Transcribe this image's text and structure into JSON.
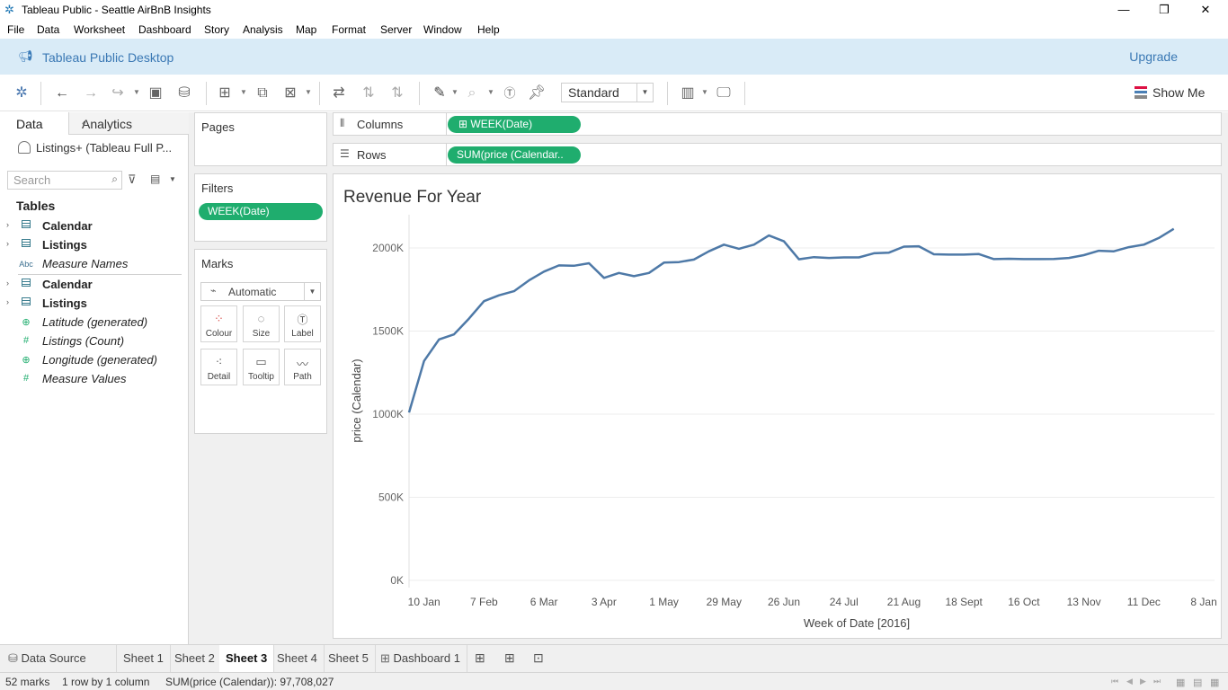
{
  "window": {
    "title": "Tableau Public - Seattle AirBnB Insights"
  },
  "menu": [
    "File",
    "Data",
    "Worksheet",
    "Dashboard",
    "Story",
    "Analysis",
    "Map",
    "Format",
    "Server",
    "Window",
    "Help"
  ],
  "banner": {
    "title": "Tableau Public Desktop",
    "upgrade": "Upgrade"
  },
  "toolbar": {
    "fit_select": "Standard",
    "show_me": "Show Me"
  },
  "datapane": {
    "tab_data": "Data",
    "tab_analytics": "Analytics",
    "datasource": "Listings+ (Tableau Full P...",
    "search_placeholder": "Search",
    "tables_heading": "Tables",
    "fields": [
      {
        "label": "Calendar",
        "icon": "table-icon"
      },
      {
        "label": "Listings",
        "icon": "table-icon"
      },
      {
        "label": "Measure Names",
        "icon": "Abc"
      },
      {
        "label": "Calendar",
        "icon": "table-icon"
      },
      {
        "label": "Listings",
        "icon": "table-icon"
      },
      {
        "label": "Latitude (generated)",
        "icon": "globe-icon"
      },
      {
        "label": "Listings (Count)",
        "icon": "#"
      },
      {
        "label": "Longitude (generated)",
        "icon": "globe-icon"
      },
      {
        "label": "Measure Values",
        "icon": "#"
      }
    ]
  },
  "cards": {
    "pages": "Pages",
    "filters": "Filters",
    "filter_pill": "WEEK(Date)",
    "marks": "Marks",
    "marks_type": "Automatic",
    "mark_buttons": [
      "Colour",
      "Size",
      "Label",
      "Detail",
      "Tooltip",
      "Path"
    ]
  },
  "shelves": {
    "columns_label": "Columns",
    "columns_pill": "WEEK(Date)",
    "rows_label": "Rows",
    "rows_pill": "SUM(price (Calendar.."
  },
  "chart_data": {
    "type": "line",
    "title": "Revenue For Year",
    "xlabel": "Week of Date [2016]",
    "ylabel": "price (Calendar)",
    "yticks": [
      "0K",
      "500K",
      "1000K",
      "1500K",
      "2000K"
    ],
    "ytick_values": [
      0,
      500000,
      1000000,
      1500000,
      2000000
    ],
    "ylim": [
      0,
      2200000
    ],
    "xticks": [
      "10 Jan",
      "7 Feb",
      "6 Mar",
      "3 Apr",
      "1 May",
      "29 May",
      "26 Jun",
      "24 Jul",
      "21 Aug",
      "18 Sept",
      "16 Oct",
      "13 Nov",
      "11 Dec",
      "8 Jan"
    ],
    "xlim": [
      "2016-01-03",
      "2017-01-13"
    ],
    "line_color": "#4e79a7",
    "x": [
      "2016-01-03",
      "2016-01-10",
      "2016-01-17",
      "2016-01-24",
      "2016-01-31",
      "2016-02-07",
      "2016-02-14",
      "2016-02-21",
      "2016-02-28",
      "2016-03-06",
      "2016-03-13",
      "2016-03-20",
      "2016-03-27",
      "2016-04-03",
      "2016-04-10",
      "2016-04-17",
      "2016-04-24",
      "2016-05-01",
      "2016-05-08",
      "2016-05-15",
      "2016-05-22",
      "2016-05-29",
      "2016-06-05",
      "2016-06-12",
      "2016-06-19",
      "2016-06-26",
      "2016-07-03",
      "2016-07-10",
      "2016-07-17",
      "2016-07-24",
      "2016-07-31",
      "2016-08-07",
      "2016-08-14",
      "2016-08-21",
      "2016-08-28",
      "2016-09-04",
      "2016-09-11",
      "2016-09-18",
      "2016-09-25",
      "2016-10-02",
      "2016-10-09",
      "2016-10-16",
      "2016-10-23",
      "2016-10-30",
      "2016-11-06",
      "2016-11-13",
      "2016-11-20",
      "2016-11-27",
      "2016-12-04",
      "2016-12-11",
      "2016-12-18",
      "2016-12-25"
    ],
    "values": [
      1010000,
      1320000,
      1450000,
      1480000,
      1575000,
      1680000,
      1715000,
      1740000,
      1805000,
      1858000,
      1895000,
      1893000,
      1908000,
      1820000,
      1850000,
      1830000,
      1850000,
      1912000,
      1915000,
      1930000,
      1980000,
      2020000,
      1995000,
      2020000,
      2075000,
      2040000,
      1932000,
      1945000,
      1940000,
      1943000,
      1943000,
      1968000,
      1972000,
      2008000,
      2010000,
      1962000,
      1960000,
      1960000,
      1963000,
      1933000,
      1935000,
      1933000,
      1933000,
      1934000,
      1940000,
      1957000,
      1983000,
      1980000,
      2005000,
      2020000,
      2060000,
      2115000
    ]
  },
  "sheet_tabs": [
    "Data Source",
    "Sheet 1",
    "Sheet 2",
    "Sheet 3",
    "Sheet 4",
    "Sheet 5",
    "Dashboard 1"
  ],
  "active_tab": "Sheet 3",
  "status": {
    "marks": "52 marks",
    "dims": "1 row by 1 column",
    "sum": "SUM(price (Calendar)): 97,708,027"
  }
}
